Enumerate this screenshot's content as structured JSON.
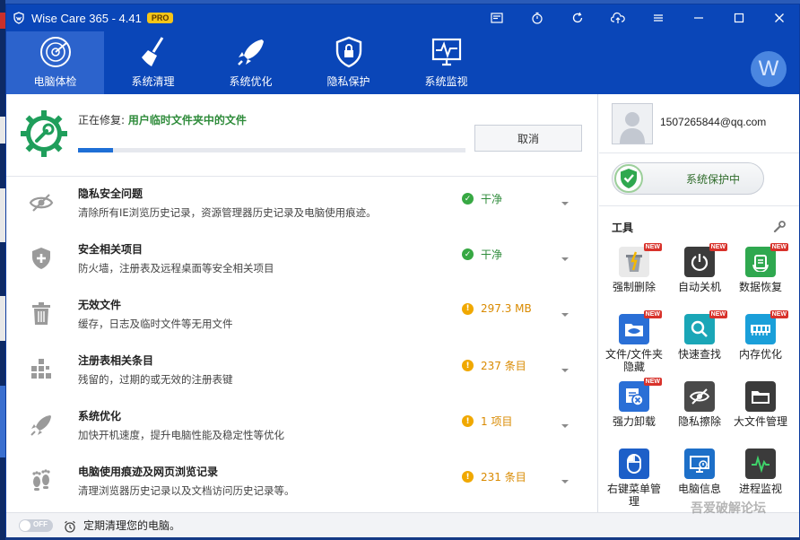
{
  "window": {
    "title": "Wise Care 365 - 4.41",
    "badge": "PRO",
    "avatar_letter": "W"
  },
  "nav": [
    {
      "label": "电脑体检",
      "active": true
    },
    {
      "label": "系统清理",
      "active": false
    },
    {
      "label": "系统优化",
      "active": false
    },
    {
      "label": "隐私保护",
      "active": false
    },
    {
      "label": "系统监视",
      "active": false
    }
  ],
  "repair": {
    "prefix": "正在修复: ",
    "item": "用户临时文件夹中的文件",
    "progress": 0.09,
    "cancel_label": "取消"
  },
  "issues": [
    {
      "title": "隐私安全问题",
      "desc": "清除所有IE浏览历史记录，资源管理器历史记录及电脑使用痕迹。",
      "status": "干净",
      "kind": "ok",
      "icon": "eye-off-icon"
    },
    {
      "title": "安全相关项目",
      "desc": "防火墙，注册表及远程桌面等安全相关项目",
      "status": "干净",
      "kind": "ok",
      "icon": "shield-plus-icon"
    },
    {
      "title": "无效文件",
      "desc": "缓存，日志及临时文件等无用文件",
      "status": "297.3 MB",
      "kind": "warn",
      "icon": "trash-icon"
    },
    {
      "title": "注册表相关条目",
      "desc": "残留的，过期的或无效的注册表键",
      "status": "237 条目",
      "kind": "warn",
      "icon": "registry-blocks-icon"
    },
    {
      "title": "系统优化",
      "desc": "加快开机速度，提升电脑性能及稳定性等优化",
      "status": "1 项目",
      "kind": "warn",
      "icon": "rocket-icon"
    },
    {
      "title": "电脑使用痕迹及网页浏览记录",
      "desc": "清理浏览器历史记录以及文档访问历史记录等。",
      "status": "231 条目",
      "kind": "warn",
      "icon": "footprints-icon"
    }
  ],
  "footer": {
    "toggle_label": "OFF",
    "text": "定期清理您的电脑。"
  },
  "user": {
    "email": "1507265844@qq.com"
  },
  "protection": {
    "label": "系统保护中"
  },
  "tools": {
    "title": "工具",
    "new_badge": "NEW",
    "items": [
      {
        "label": "强制删除",
        "icon": "force-delete-icon",
        "color": "#e9e9e9",
        "is_new": true
      },
      {
        "label": "自动关机",
        "icon": "power-icon",
        "color": "#3b3b3b",
        "is_new": true
      },
      {
        "label": "数据恢复",
        "icon": "data-recovery-icon",
        "color": "#2fa84f",
        "is_new": true
      },
      {
        "label": "文件/文件夹隐藏",
        "icon": "folder-hide-icon",
        "color": "#2a6fd6",
        "is_new": true
      },
      {
        "label": "快速查找",
        "icon": "search-icon",
        "color": "#1aa6b7",
        "is_new": true
      },
      {
        "label": "内存优化",
        "icon": "memory-icon",
        "color": "#1a9fd9",
        "is_new": true
      },
      {
        "label": "强力卸载",
        "icon": "uninstall-icon",
        "color": "#2a6fd6",
        "is_new": true
      },
      {
        "label": "隐私擦除",
        "icon": "privacy-erase-icon",
        "color": "#4a4a4a",
        "is_new": false
      },
      {
        "label": "大文件管理",
        "icon": "big-file-icon",
        "color": "#3b3b3b",
        "is_new": false
      },
      {
        "label": "右键菜单管理",
        "icon": "mouse-icon",
        "color": "#1d5fc8",
        "is_new": false
      },
      {
        "label": "电脑信息",
        "icon": "computer-info-icon",
        "color": "#1d6fc8",
        "is_new": false
      },
      {
        "label": "进程监视",
        "icon": "process-monitor-icon",
        "color": "#3b3b3b",
        "is_new": false
      }
    ]
  },
  "watermark": "吾爱破解论坛"
}
